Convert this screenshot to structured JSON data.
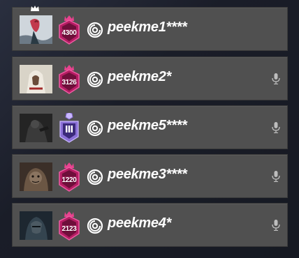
{
  "squad": {
    "players": [
      {
        "name": "peekme1****",
        "rank_value": "4300",
        "rank_tier": "champion",
        "has_crown": true,
        "has_mic": false
      },
      {
        "name": "peekme2*",
        "rank_value": "3126",
        "rank_tier": "champion",
        "has_crown": false,
        "has_mic": true
      },
      {
        "name": "peekme5****",
        "rank_value": "",
        "rank_tier": "diamond",
        "has_crown": false,
        "has_mic": true
      },
      {
        "name": "peekme3****",
        "rank_value": "1220",
        "rank_tier": "champion",
        "has_crown": false,
        "has_mic": true
      },
      {
        "name": "peekme4*",
        "rank_value": "2123",
        "rank_tier": "champion",
        "has_crown": false,
        "has_mic": true
      }
    ]
  },
  "icons": {
    "crown": "crown-icon",
    "platform": "ubisoft-swirl-icon",
    "mic": "microphone-icon",
    "rank_champion": "champion-rank-icon",
    "rank_diamond": "diamond-rank-icon"
  },
  "colors": {
    "row_bg": "#505050",
    "champion": "#d4287a",
    "diamond": "#8a6fd6",
    "text": "#ffffff"
  }
}
